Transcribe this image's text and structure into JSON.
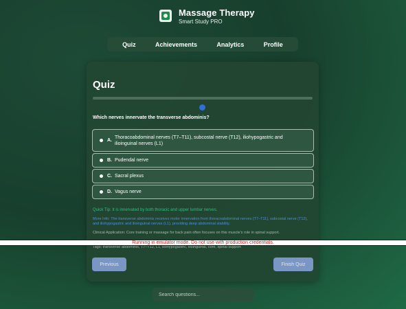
{
  "app": {
    "title": "Massage Therapy",
    "subtitle": "Smart Study PRO"
  },
  "nav": {
    "items": [
      {
        "label": "Quiz"
      },
      {
        "label": "Achievements"
      },
      {
        "label": "Analytics"
      },
      {
        "label": "Profile"
      }
    ]
  },
  "quiz": {
    "title": "Quiz",
    "question": "Which nerves innervate the transverse abdominis?",
    "options": [
      {
        "letter": "A.",
        "text": "Thoracoabdominal nerves (T7–T11), subcostal nerve (T12), iliohypogastric and ilioinguinal nerves (L1)"
      },
      {
        "letter": "B.",
        "text": "Pudendal nerve"
      },
      {
        "letter": "C.",
        "text": "Sacral plexus"
      },
      {
        "letter": "D.",
        "text": "Vagus nerve"
      }
    ],
    "quick_tip": "Quick Tip: It is innervated by both thoracic and upper lumbar nerves.",
    "more_info": "More Info: The transverse abdominis receives motor innervation from thoracoabdominal nerves (T7–T11), subcostal nerve (T12), and iliohypogastric and ilioinguinal nerves (L1), providing deep abdominal stability.",
    "clinical": "Clinical Application: Core training or massage for back pain often focuses on this muscle's role in spinal support.",
    "tags": "Tags: transverse abdominis, T7–T12, L1, iliohypogastric, ilioinguinal, core, spinal support",
    "prev_label": "Previous",
    "finish_label": "Finish Quiz"
  },
  "emulator_banner": "Running in emulator mode. Do not use with production credentials.",
  "search": {
    "placeholder": "Search questions..."
  }
}
